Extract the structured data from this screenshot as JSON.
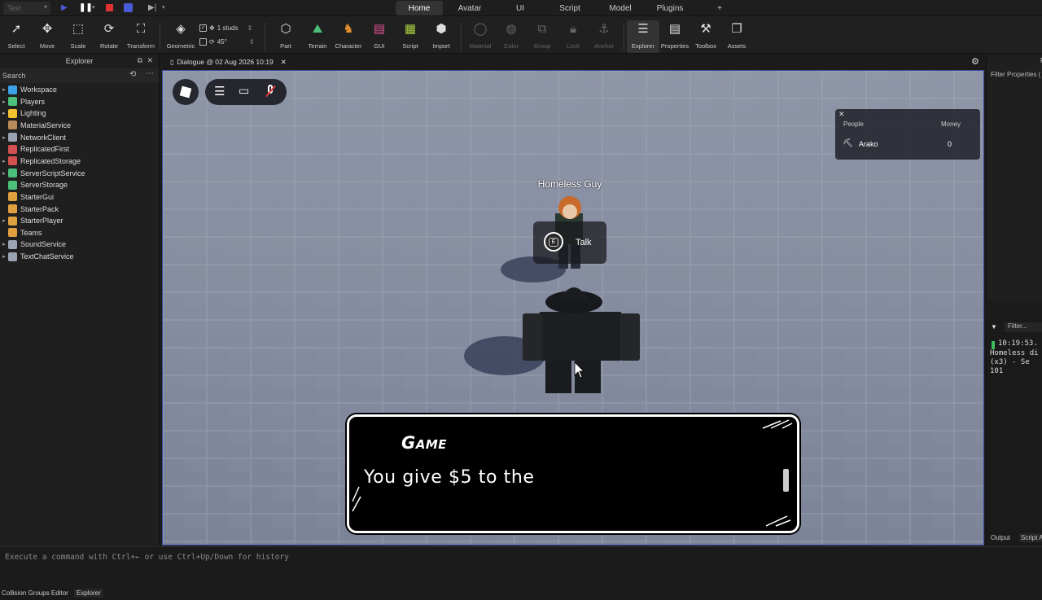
{
  "titlebar": {
    "mode": "Test",
    "tabs": [
      "Home",
      "Avatar",
      "UI",
      "Script",
      "Model",
      "Plugins"
    ],
    "active_tab": "Home",
    "add_tab": "+"
  },
  "ribbon": {
    "tools": [
      "Select",
      "Move",
      "Scale",
      "Rotate",
      "Transform"
    ],
    "geometric": "Geometric",
    "snap_move": "1 studs",
    "snap_rotate": "45°",
    "insert": [
      "Part",
      "Terrain",
      "Character",
      "GUI",
      "Script",
      "Import"
    ],
    "modify": [
      "Material",
      "Color",
      "Group",
      "Lock",
      "Anchor"
    ],
    "panels": [
      "Explorer",
      "Properties",
      "Toolbox",
      "Assets"
    ]
  },
  "explorer": {
    "title": "Explorer",
    "search_placeholder": "Search",
    "items": [
      {
        "label": "Workspace",
        "color": "#3aa0e8",
        "expand": true
      },
      {
        "label": "Players",
        "color": "#4cc07a",
        "expand": true
      },
      {
        "label": "Lighting",
        "color": "#f2c230",
        "expand": true
      },
      {
        "label": "MaterialService",
        "color": "#b98a5a",
        "expand": false
      },
      {
        "label": "NetworkClient",
        "color": "#9aa4b2",
        "expand": true
      },
      {
        "label": "ReplicatedFirst",
        "color": "#d45050",
        "expand": false
      },
      {
        "label": "ReplicatedStorage",
        "color": "#d45050",
        "expand": true
      },
      {
        "label": "ServerScriptService",
        "color": "#4cc07a",
        "expand": true
      },
      {
        "label": "ServerStorage",
        "color": "#4cc07a",
        "expand": false
      },
      {
        "label": "StarterGui",
        "color": "#e0a040",
        "expand": false
      },
      {
        "label": "StarterPack",
        "color": "#e0a040",
        "expand": false
      },
      {
        "label": "StarterPlayer",
        "color": "#e0a040",
        "expand": true
      },
      {
        "label": "Teams",
        "color": "#e0a040",
        "expand": false
      },
      {
        "label": "SoundService",
        "color": "#9aa4b2",
        "expand": true
      },
      {
        "label": "TextChatService",
        "color": "#9aa4b2",
        "expand": true
      }
    ],
    "bottom_tabs": [
      "Collision Groups Editor",
      "Explorer"
    ]
  },
  "document_tab": "Dialogue @ 02 Aug 2026 10:19",
  "game": {
    "leaderboard": {
      "col1": "People",
      "col2": "Money",
      "player": "Arako",
      "money": "0"
    },
    "npc_name": "Homeless Guy",
    "prompt_key": "E",
    "prompt_action": "Talk",
    "dialogue_speaker": "Game",
    "dialogue_text": "You give $5 to the"
  },
  "properties": {
    "filter_placeholder": "Filter Properties (",
    "title": "P"
  },
  "output": {
    "filter": "Filter...",
    "lines": [
      "10:19:53.",
      "Homeless di",
      "(x3)  -  Se",
      "101"
    ],
    "tabs": [
      "Output",
      "Script A"
    ]
  },
  "command_bar": {
    "placeholder": "Execute a command with Ctrl+← or use Ctrl+Up/Down for history"
  }
}
